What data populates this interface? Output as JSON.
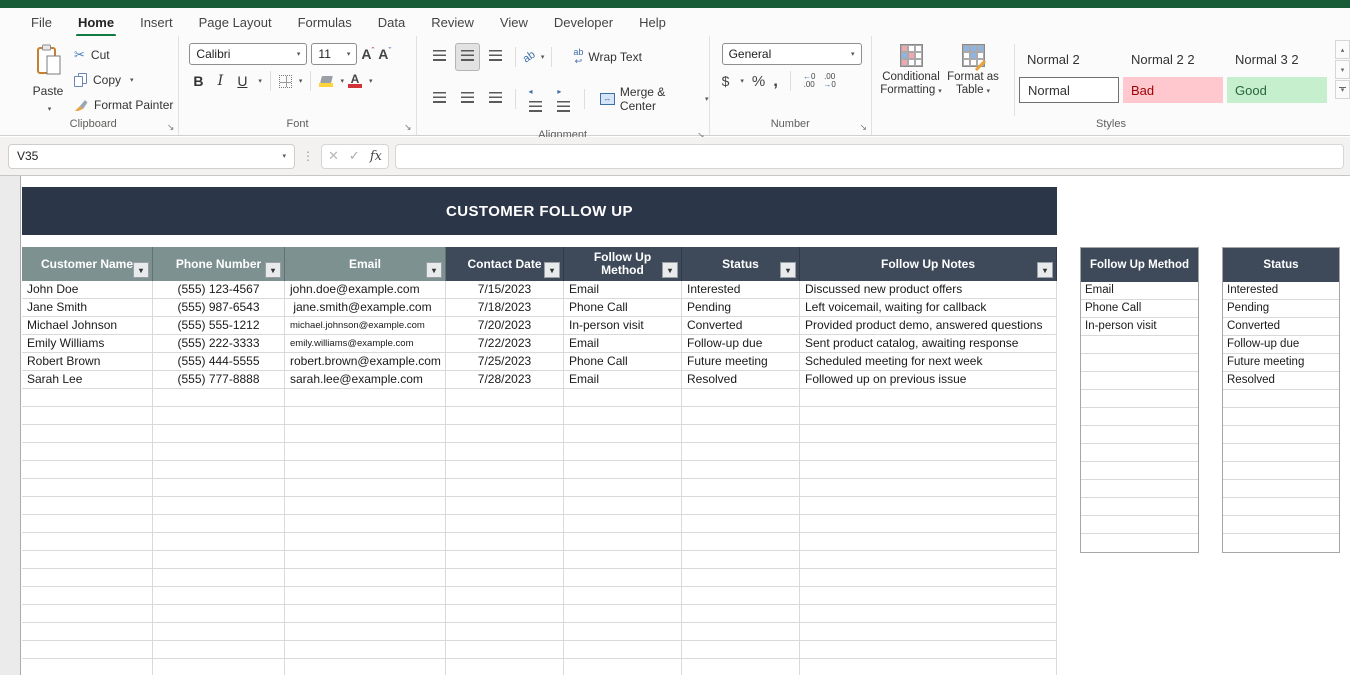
{
  "chrome": {
    "menu": [
      "File",
      "Home",
      "Insert",
      "Page Layout",
      "Formulas",
      "Data",
      "Review",
      "View",
      "Developer",
      "Help"
    ],
    "active_tab": "Home"
  },
  "ribbon": {
    "clipboard": {
      "label": "Clipboard",
      "paste": "Paste",
      "cut": "Cut",
      "copy": "Copy",
      "format_painter": "Format Painter"
    },
    "font": {
      "label": "Font",
      "name": "Calibri",
      "size": "11"
    },
    "alignment": {
      "label": "Alignment",
      "wrap_text": "Wrap Text",
      "merge_center": "Merge & Center"
    },
    "number": {
      "label": "Number",
      "format": "General"
    },
    "styles": {
      "label": "Styles",
      "conditional_line1": "Conditional",
      "conditional_line2": "Formatting",
      "format_table_line1": "Format as",
      "format_table_line2": "Table",
      "gallery": [
        "Normal 2",
        "Normal 2 2",
        "Normal 3 2",
        "Normal",
        "Bad",
        "Good"
      ]
    }
  },
  "formula_bar": {
    "name_box": "V35",
    "formula": ""
  },
  "sheet": {
    "title": "CUSTOMER FOLLOW UP",
    "columns": [
      "Customer Name",
      "Phone Number",
      "Email",
      "Contact Date",
      "Follow Up Method",
      "Status",
      "Follow Up Notes"
    ],
    "rows": [
      [
        "John Doe",
        "(555) 123-4567",
        "john.doe@example.com",
        "7/15/2023",
        "Email",
        "Interested",
        "Discussed new product offers"
      ],
      [
        "Jane Smith",
        "(555) 987-6543",
        " jane.smith@example.com",
        "7/18/2023",
        "Phone Call",
        "Pending",
        "Left voicemail, waiting for callback"
      ],
      [
        "Michael Johnson",
        "(555) 555-1212",
        "michael.johnson@example.com",
        "7/20/2023",
        "In-person visit",
        "Converted",
        "Provided product demo, answered questions"
      ],
      [
        "Emily Williams",
        "(555) 222-3333",
        "emily.williams@example.com",
        "7/22/2023",
        "Email",
        "Follow-up due",
        "Sent product catalog, awaiting response"
      ],
      [
        "Robert Brown",
        "(555) 444-5555",
        "robert.brown@example.com",
        "7/25/2023",
        "Phone Call",
        "Future meeting",
        "Scheduled meeting for next week"
      ],
      [
        "Sarah Lee",
        "(555) 777-8888",
        "sarah.lee@example.com",
        "7/28/2023",
        "Email",
        "Resolved",
        "Followed up on previous issue"
      ]
    ],
    "lookups": {
      "method": {
        "header": "Follow Up Method",
        "items": [
          "Email",
          "Phone Call",
          "In-person visit"
        ]
      },
      "status": {
        "header": "Status",
        "items": [
          "Interested",
          "Pending",
          "Converted",
          "Follow-up due",
          "Future meeting",
          "Resolved"
        ]
      }
    }
  },
  "icons": {
    "cut": "✂",
    "caret": "▾",
    "filter": "▾",
    "cancel": "✕",
    "confirm": "✓",
    "fx": "fx",
    "dots": "⋮",
    "up": "▴",
    "down": "▾",
    "launcher": "↘",
    "bold": "B",
    "italic": "I",
    "underline": "U",
    "dollar": "$",
    "percent": "%",
    "comma": ","
  },
  "colors": {
    "brand_green": "#185C37",
    "accent_green": "#107C41",
    "title_dark": "#2B3648",
    "header_dark": "#3E4A5A",
    "header_sage": "#7E9191",
    "bad_bg": "#FFC7CE",
    "bad_text": "#9C0006",
    "good_bg": "#C6EFCE",
    "good_text": "#276738"
  }
}
